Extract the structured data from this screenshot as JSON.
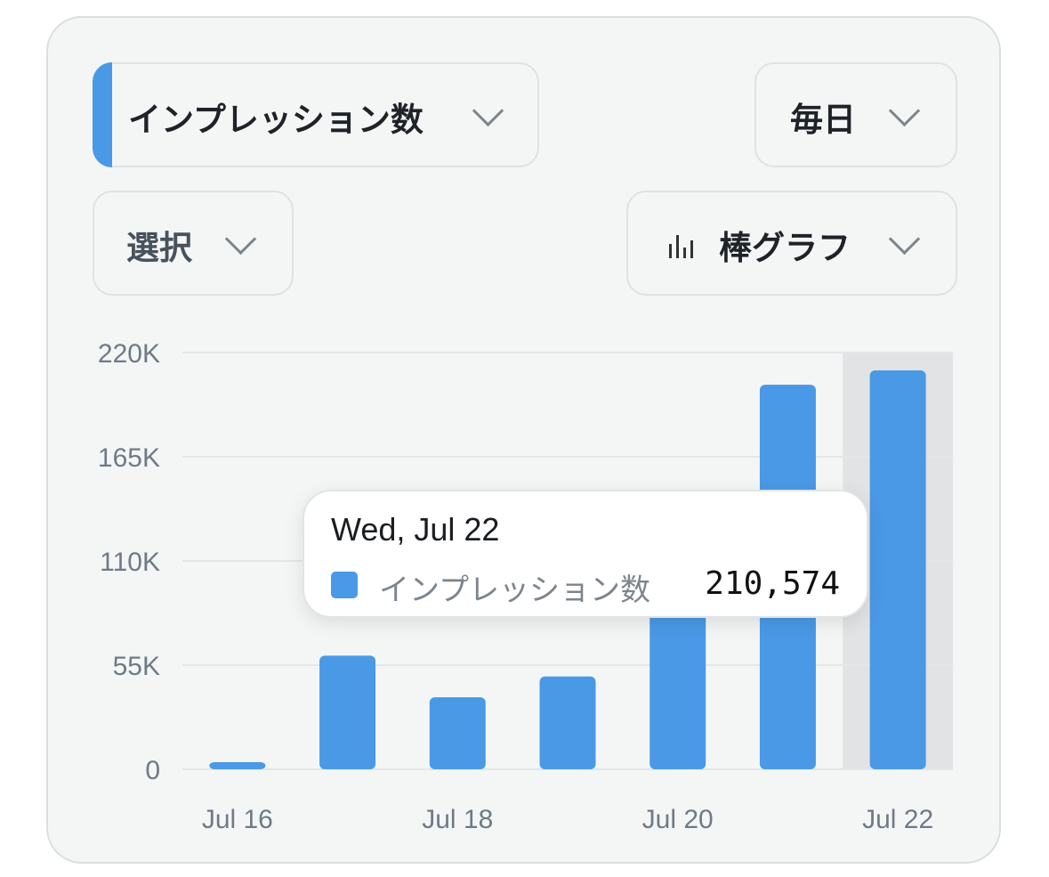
{
  "controls": {
    "metric_label": "インプレッション数",
    "period_label": "毎日",
    "filter_label": "選択",
    "chart_type_label": "棒グラフ"
  },
  "tooltip": {
    "date": "Wed, Jul 22",
    "series_name": "インプレッション数",
    "value": "210,574"
  },
  "colors": {
    "accent": "#4a99e6",
    "highlight": "#e1e3e4",
    "grid": "#e3e7ea"
  },
  "chart_data": {
    "type": "bar",
    "categories": [
      "Jul 16",
      "Jul 17",
      "Jul 18",
      "Jul 19",
      "Jul 20",
      "Jul 21",
      "Jul 22"
    ],
    "x_tick_labels": [
      "Jul 16",
      "",
      "Jul 18",
      "",
      "Jul 20",
      "",
      "Jul 22"
    ],
    "series": [
      {
        "name": "インプレッション数",
        "values": [
          3000,
          60000,
          38000,
          49000,
          90000,
          203000,
          210574
        ]
      }
    ],
    "y_ticks": [
      0,
      55000,
      110000,
      165000,
      220000
    ],
    "y_tick_labels": [
      "0",
      "55K",
      "110K",
      "165K",
      "220K"
    ],
    "ylim": [
      0,
      220000
    ],
    "highlighted_category": "Jul 22",
    "grid": true
  }
}
